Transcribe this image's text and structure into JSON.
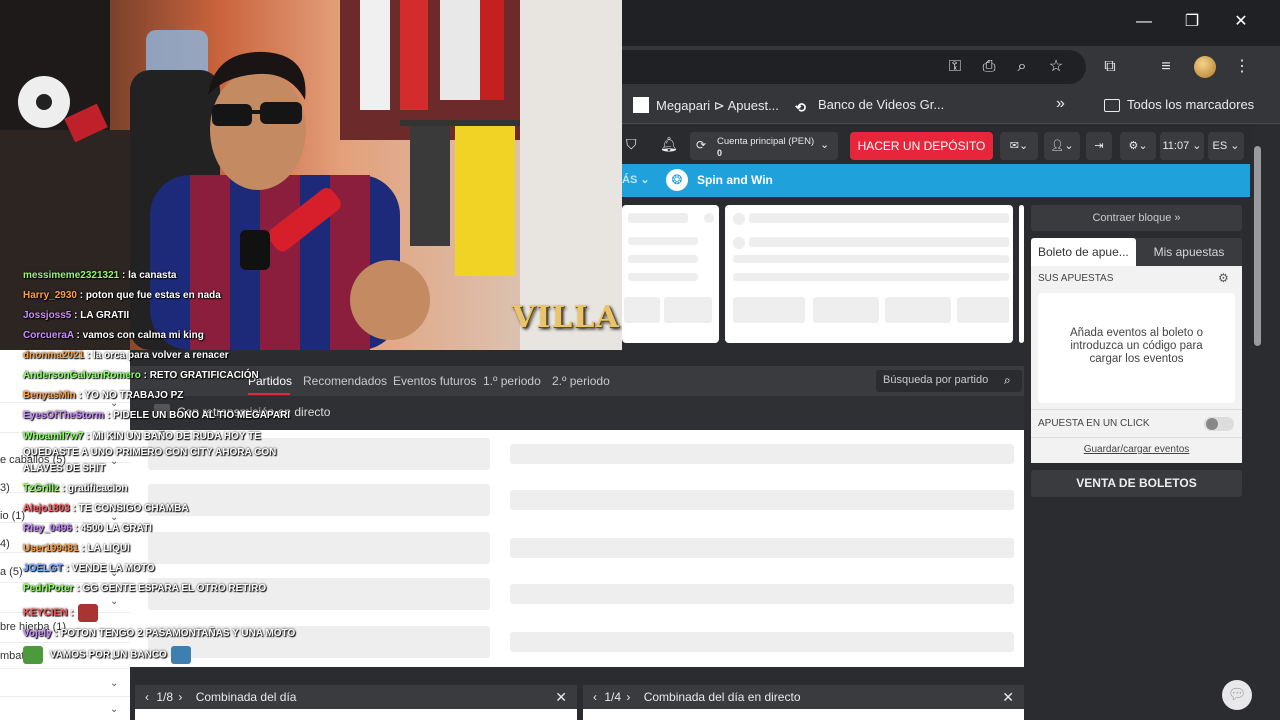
{
  "window": {
    "minimize": "—",
    "restore": "❐",
    "close": "✕"
  },
  "bookmarks": {
    "item1": "Megapari ⊳ Apuest...",
    "item2": "Banco de Videos Gr...",
    "more": "»",
    "all": "Todos los marcadores"
  },
  "header": {
    "account_label": "Cuenta principal (PEN)",
    "account_value": "0",
    "deposit": "HACER UN DEPÓSITO",
    "time": "11:07",
    "lang": "ES"
  },
  "promo": {
    "left": "ÁS ⌄",
    "label": "Spin and Win"
  },
  "sidebar": {
    "collapse": "Contraer bloque »",
    "tab_slip": "Boleto de apue...",
    "tab_bets": "Mis apuestas",
    "your_bets": "SUS APUESTAS",
    "empty": "Añada eventos al boleto o introduzca un código para cargar los eventos",
    "one_click": "APUESTA EN UN CLICK",
    "save_load": "Guardar/cargar eventos",
    "ticket_sale": "VENTA DE BOLETOS"
  },
  "tabs": [
    "Partidos",
    "Recomendados",
    "Eventos futuros",
    "1.º periodo",
    "2.º periodo"
  ],
  "search_placeholder": "Búsqueda por partido",
  "subbar": "Con retransmisión en directo",
  "combos": [
    {
      "pager": "1/8",
      "title": "Combinada del día"
    },
    {
      "pager": "1/4",
      "title": "Combinada del día en directo"
    }
  ],
  "left_items": [
    "e caballos (5)",
    "3)",
    "io (1)",
    "4)",
    "a (5)",
    "bre hierba (1)",
    "mbat (2)"
  ],
  "overlay": {
    "watermark": "VILLA"
  },
  "chat": [
    {
      "user": "messimeme2321321",
      "msg": ": la canasta",
      "color": "#9cf07a"
    },
    {
      "user": "Harry_2930",
      "msg": ": poton que fue estas en nada",
      "color": "#ff9f40"
    },
    {
      "user": "Jossjoss5",
      "msg": ": LA GRATII",
      "color": "#c98cff"
    },
    {
      "user": "CorcueraA",
      "msg": ": vamos con calma mi king",
      "color": "#c98cff"
    },
    {
      "user": "dnonma2021",
      "msg": ": la orca para volver a renacer",
      "color": "#ff9f40"
    },
    {
      "user": "AndersonGalvanRomero",
      "msg": ": RETO GRATIFICACIÓN",
      "color": "#8cff66"
    },
    {
      "user": "BenyasMin",
      "msg": ": YO NO TRABAJO PZ",
      "color": "#ff9f40"
    },
    {
      "user": "EyesOfTheStorm",
      "msg": ": PIDELE UN BONO AL TIO MEGAPARI",
      "color": "#c98cff"
    },
    {
      "user": "Whoamil7w7",
      "msg": ": MI KIN UN BAÑO DE RUDA HOY TE",
      "color": "#8cff66"
    },
    {
      "user": "",
      "msg": "QUEDASTE A UNO PRIMERO CON CITY AHORA CON",
      "color": "#fff"
    },
    {
      "user": "",
      "msg": "ALAVES DE SHIT",
      "color": "#fff"
    },
    {
      "user": "TzGrillz",
      "msg": ": gratificacion",
      "color": "#8cff66"
    },
    {
      "user": "Alejo1803",
      "msg": ": TE CONSIGO CHAMBA",
      "color": "#ff5a5a"
    },
    {
      "user": "Riey_0496",
      "msg": ": 4500 LA GRATI",
      "color": "#c98cff"
    },
    {
      "user": "User199481",
      "msg": ": LA LIQUI",
      "color": "#ff9f40"
    },
    {
      "user": "JOELGT",
      "msg": ": VENDE LA MOTO",
      "color": "#6fa8ff"
    },
    {
      "user": "PedriPoter",
      "msg": ": GG GENTE ESPARA EL OTRO RETIRO",
      "color": "#8cff66"
    },
    {
      "user": "KEYCIEN",
      "msg": ":",
      "color": "#ff5a5a"
    },
    {
      "user": "Vojely",
      "msg": ": POTON TENGO 2 PASAMONTAÑAS Y UNA MOTO",
      "color": "#c98cff"
    },
    {
      "user": "",
      "msg": "VAMOS POR UN BANCO",
      "color": "#fff"
    }
  ]
}
